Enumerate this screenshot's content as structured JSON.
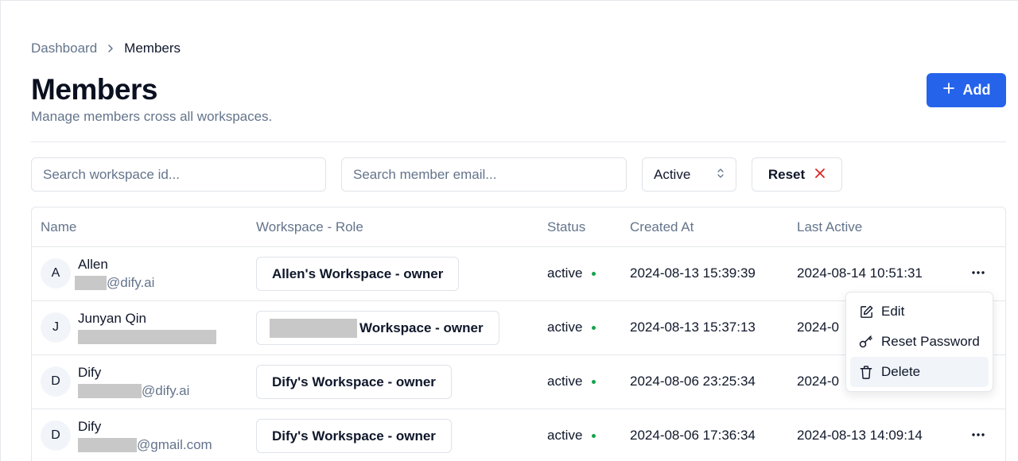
{
  "breadcrumb": {
    "parent": "Dashboard",
    "current": "Members"
  },
  "page": {
    "title": "Members",
    "subtitle": "Manage members cross all workspaces."
  },
  "actions": {
    "add_label": "Add"
  },
  "filters": {
    "workspace_placeholder": "Search workspace id...",
    "email_placeholder": "Search member email...",
    "status_value": "Active",
    "reset_label": "Reset"
  },
  "table": {
    "columns": [
      "Name",
      "Workspace - Role",
      "Status",
      "Created At",
      "Last Active"
    ],
    "rows": [
      {
        "initial": "A",
        "name": "Allen",
        "email_suffix": "@dify.ai",
        "workspace": "Allen's Workspace - owner",
        "status": "active",
        "created": "2024-08-13 15:39:39",
        "last_active": "2024-08-14 10:51:31"
      },
      {
        "initial": "J",
        "name": "Junyan Qin",
        "email_suffix": "",
        "workspace": "Workspace - owner",
        "status": "active",
        "created": "2024-08-13 15:37:13",
        "last_active": "2024-0"
      },
      {
        "initial": "D",
        "name": "Dify",
        "email_suffix": "@dify.ai",
        "workspace": "Dify's Workspace - owner",
        "status": "active",
        "created": "2024-08-06 23:25:34",
        "last_active": "2024-0"
      },
      {
        "initial": "D",
        "name": "Dify",
        "email_suffix": "@gmail.com",
        "workspace": "Dify's Workspace - owner",
        "status": "active",
        "created": "2024-08-06 17:36:34",
        "last_active": "2024-08-13 14:09:14"
      }
    ]
  },
  "row_menu": {
    "edit": "Edit",
    "reset_password": "Reset Password",
    "delete": "Delete"
  },
  "colors": {
    "primary": "#2563eb",
    "status_active": "#16a34a",
    "reset_x": "#dc2626",
    "muted": "#64748b"
  }
}
